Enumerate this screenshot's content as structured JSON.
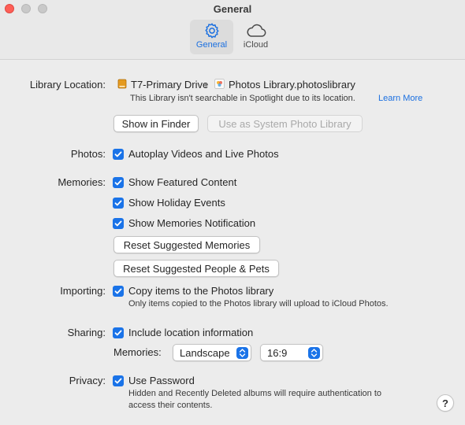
{
  "window": {
    "title": "General"
  },
  "tabs": [
    {
      "label": "General",
      "icon": "gear-icon",
      "selected": true
    },
    {
      "label": "iCloud",
      "icon": "cloud-icon",
      "selected": false
    }
  ],
  "library": {
    "label": "Library Location:",
    "drive": "T7-Primary Drive",
    "separator": "›",
    "library_name": "Photos Library.photoslibrary",
    "note": "This Library isn't searchable in Spotlight due to its location.",
    "learn_more": "Learn More",
    "show_in_finder": "Show in Finder",
    "use_as_system": "Use as System Photo Library"
  },
  "photos": {
    "label": "Photos:",
    "autoplay": {
      "label": "Autoplay Videos and Live Photos",
      "checked": true
    }
  },
  "memories": {
    "label": "Memories:",
    "featured": {
      "label": "Show Featured Content",
      "checked": true
    },
    "holiday": {
      "label": "Show Holiday Events",
      "checked": true
    },
    "notification": {
      "label": "Show Memories Notification",
      "checked": true
    },
    "reset_memories": "Reset Suggested Memories",
    "reset_people": "Reset Suggested People & Pets"
  },
  "importing": {
    "label": "Importing:",
    "copy": {
      "label": "Copy items to the Photos library",
      "checked": true
    },
    "note": "Only items copied to the Photos library will upload to iCloud Photos."
  },
  "sharing": {
    "label": "Sharing:",
    "location": {
      "label": "Include location information",
      "checked": true
    },
    "memories_label": "Memories:",
    "orientation": "Landscape",
    "aspect": "16:9"
  },
  "privacy": {
    "label": "Privacy:",
    "password": {
      "label": "Use Password",
      "checked": true
    },
    "note_line1": "Hidden and Recently Deleted albums will require authentication to",
    "note_line2": "access their contents."
  },
  "help": {
    "label": "?"
  },
  "colors": {
    "accent": "#1a73e8",
    "close": "#fe5f57"
  }
}
